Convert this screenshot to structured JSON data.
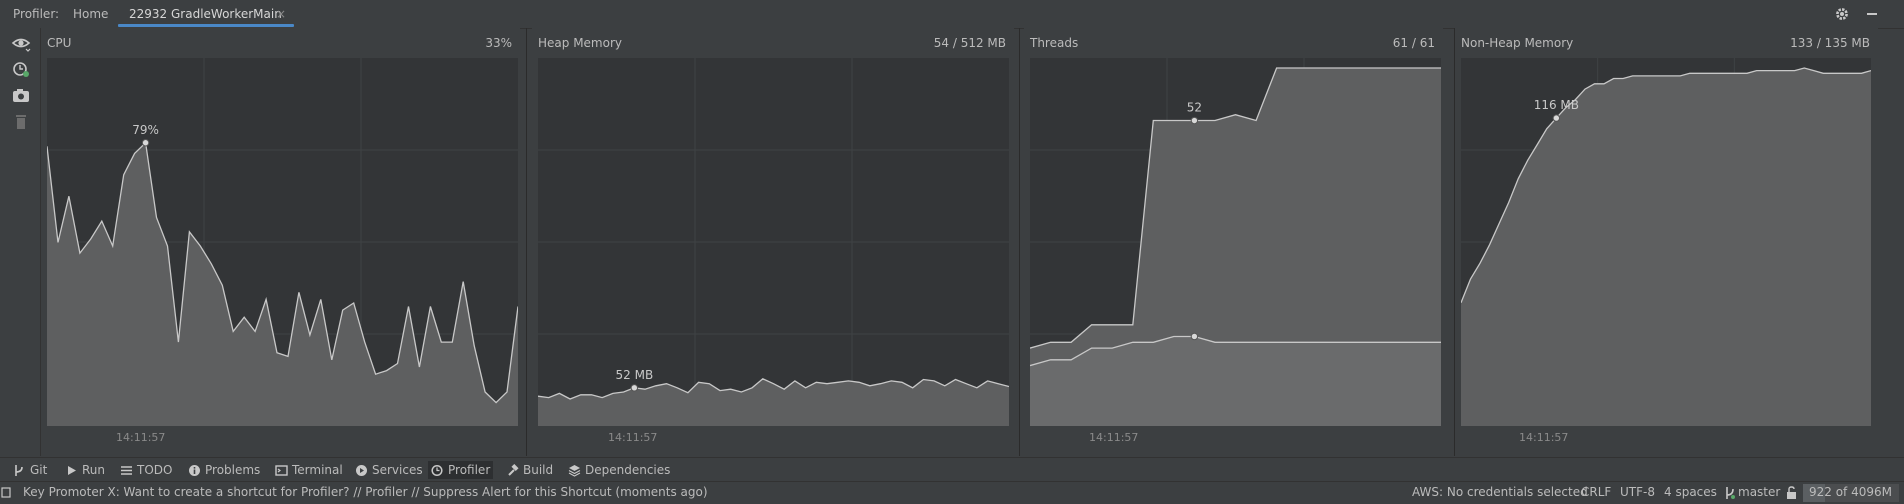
{
  "header": {
    "profiler_label": "Profiler:",
    "tabs": [
      {
        "label": "Home",
        "active": false
      },
      {
        "label": "22932 GradleWorkerMain",
        "active": true
      }
    ],
    "close_glyph": "×",
    "settings_icon": "gear-icon",
    "minimize_icon": "minimize-icon"
  },
  "left_toolbar": [
    "eye-icon",
    "record-icon",
    "camera-icon",
    "trash-icon"
  ],
  "monitors": [
    {
      "title": "CPU",
      "value": "33%",
      "time_label": "14:11:57",
      "annotations": [
        "79%"
      ]
    },
    {
      "title": "Heap Memory",
      "value": "54 / 512 MB",
      "time_label": "14:11:57",
      "annotations": [
        "52 MB"
      ]
    },
    {
      "title": "Threads",
      "value": "61 / 61",
      "time_label": "14:11:57",
      "annotations": [
        "52"
      ]
    },
    {
      "title": "Non-Heap Memory",
      "value": "133 / 135 MB",
      "time_label": "14:11:57",
      "annotations": [
        "116 MB"
      ]
    }
  ],
  "tool_windows": [
    {
      "label": "Git",
      "icon": "git-branch-icon"
    },
    {
      "label": "Run",
      "icon": "run-icon"
    },
    {
      "label": "TODO",
      "icon": "list-icon"
    },
    {
      "label": "Problems",
      "icon": "info-icon"
    },
    {
      "label": "Terminal",
      "icon": "terminal-icon"
    },
    {
      "label": "Services",
      "icon": "play-circle-icon"
    },
    {
      "label": "Profiler",
      "icon": "profiler-icon",
      "active": true
    },
    {
      "label": "Build",
      "icon": "hammer-icon"
    },
    {
      "label": "Dependencies",
      "icon": "stack-icon"
    }
  ],
  "status": {
    "message": "Key Promoter X: Want to create a shortcut for Profiler? // Profiler // Suppress Alert for this Shortcut (moments ago)",
    "aws": "AWS: No credentials selected",
    "line_sep": "CRLF",
    "encoding": "UTF-8",
    "indent": "4 spaces",
    "branch": "master",
    "memory": "922 of 4096M",
    "memory_used_fraction": 0.225
  },
  "colors": {
    "accent": "#4a88c7",
    "chart_fill": "#5e5f60",
    "chart_line": "#c8c8c8",
    "plot_bg": "#333537"
  },
  "chart_data": [
    {
      "type": "area",
      "title": "CPU",
      "ylim": [
        0,
        100
      ],
      "values": [
        78,
        51,
        64,
        48,
        52,
        57,
        50,
        70,
        76,
        79,
        58,
        50,
        23,
        54,
        50,
        45,
        39,
        26,
        30,
        26,
        35,
        20,
        19,
        37,
        25,
        35,
        18,
        32,
        34,
        23,
        14,
        15,
        17,
        33,
        16,
        33,
        23,
        23,
        40,
        22,
        9,
        6,
        9,
        33
      ],
      "annotations": [
        {
          "index": 9,
          "label": "79%"
        }
      ]
    },
    {
      "type": "area",
      "title": "Heap Memory",
      "ylim": [
        0,
        512
      ],
      "values": [
        40,
        38,
        44,
        36,
        42,
        42,
        38,
        44,
        46,
        52,
        50,
        55,
        58,
        52,
        45,
        60,
        58,
        48,
        50,
        46,
        52,
        65,
        58,
        50,
        62,
        52,
        60,
        58,
        60,
        62,
        60,
        55,
        58,
        62,
        60,
        52,
        64,
        62,
        55,
        64,
        58,
        52,
        62,
        58,
        54
      ],
      "annotations": [
        {
          "index": 9,
          "label": "52 MB"
        }
      ]
    },
    {
      "type": "area",
      "title": "Threads",
      "ylim": [
        0,
        61
      ],
      "series": [
        {
          "name": "",
          "values": [
            13,
            14,
            14,
            17,
            17,
            17,
            52,
            52,
            52,
            52,
            53,
            52,
            61,
            61,
            61,
            61,
            61,
            61,
            61,
            61,
            61
          ]
        },
        {
          "name": "",
          "values": [
            10,
            11,
            11,
            13,
            13,
            14,
            14,
            15,
            15,
            14,
            14,
            14,
            14,
            14,
            14,
            14,
            14,
            14,
            14,
            14,
            14
          ]
        }
      ],
      "annotations": [
        {
          "index": 8,
          "label": "52"
        }
      ]
    },
    {
      "type": "area",
      "title": "Non-Heap Memory",
      "ylim": [
        0,
        135
      ],
      "values": [
        46,
        55,
        61,
        68,
        76,
        84,
        93,
        100,
        106,
        112,
        116,
        120,
        123,
        127,
        129,
        129,
        131,
        131,
        132,
        132,
        132,
        132,
        132,
        132,
        133,
        133,
        133,
        133,
        133,
        133,
        133,
        134,
        134,
        134,
        134,
        134,
        135,
        134,
        133,
        133,
        133,
        133,
        133,
        134
      ],
      "annotations": [
        {
          "index": 10,
          "label": "116 MB"
        }
      ]
    }
  ]
}
